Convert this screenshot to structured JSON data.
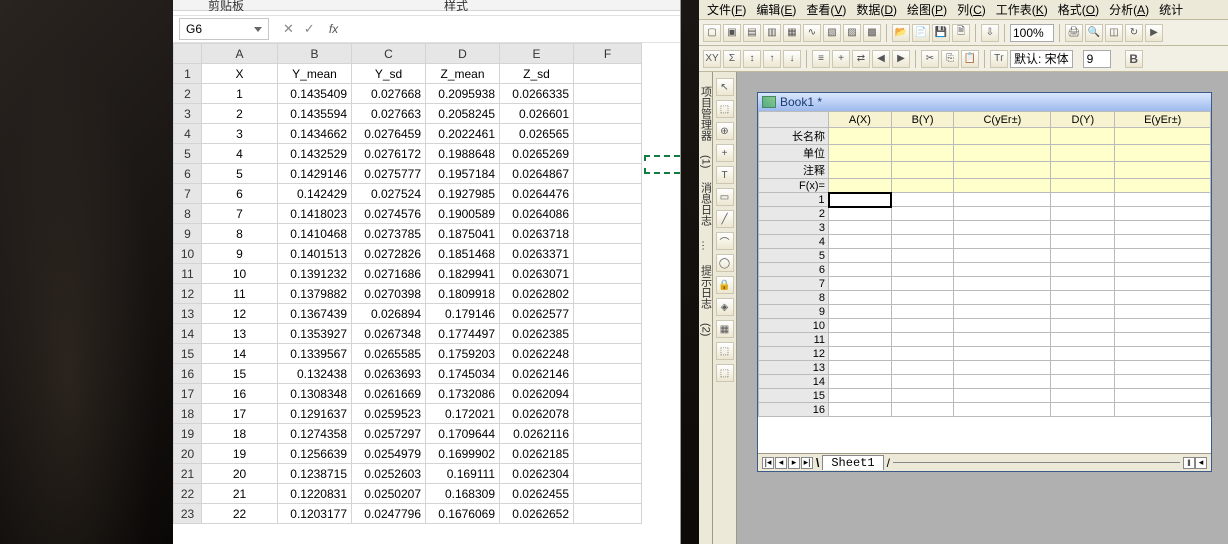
{
  "excel": {
    "ribbon": {
      "clipboard": "剪贴板",
      "styles": "样式"
    },
    "namebox": "G6",
    "fx": "fx",
    "columns": [
      "A",
      "B",
      "C",
      "D",
      "E",
      "F"
    ],
    "headers": [
      "X",
      "Y_mean",
      "Y_sd",
      "Z_mean",
      "Z_sd"
    ],
    "rows": [
      {
        "n": 1,
        "x": "1",
        "ym": "0.1435409",
        "ys": "0.027668",
        "zm": "0.2095938",
        "zs": "0.0266335"
      },
      {
        "n": 2,
        "x": "2",
        "ym": "0.1435594",
        "ys": "0.027663",
        "zm": "0.2058245",
        "zs": "0.026601"
      },
      {
        "n": 3,
        "x": "3",
        "ym": "0.1434662",
        "ys": "0.0276459",
        "zm": "0.2022461",
        "zs": "0.026565"
      },
      {
        "n": 4,
        "x": "4",
        "ym": "0.1432529",
        "ys": "0.0276172",
        "zm": "0.1988648",
        "zs": "0.0265269"
      },
      {
        "n": 5,
        "x": "5",
        "ym": "0.1429146",
        "ys": "0.0275777",
        "zm": "0.1957184",
        "zs": "0.0264867"
      },
      {
        "n": 6,
        "x": "6",
        "ym": "0.142429",
        "ys": "0.027524",
        "zm": "0.1927985",
        "zs": "0.0264476"
      },
      {
        "n": 7,
        "x": "7",
        "ym": "0.1418023",
        "ys": "0.0274576",
        "zm": "0.1900589",
        "zs": "0.0264086"
      },
      {
        "n": 8,
        "x": "8",
        "ym": "0.1410468",
        "ys": "0.0273785",
        "zm": "0.1875041",
        "zs": "0.0263718"
      },
      {
        "n": 9,
        "x": "9",
        "ym": "0.1401513",
        "ys": "0.0272826",
        "zm": "0.1851468",
        "zs": "0.0263371"
      },
      {
        "n": 10,
        "x": "10",
        "ym": "0.1391232",
        "ys": "0.0271686",
        "zm": "0.1829941",
        "zs": "0.0263071"
      },
      {
        "n": 11,
        "x": "11",
        "ym": "0.1379882",
        "ys": "0.0270398",
        "zm": "0.1809918",
        "zs": "0.0262802"
      },
      {
        "n": 12,
        "x": "12",
        "ym": "0.1367439",
        "ys": "0.026894",
        "zm": "0.179146",
        "zs": "0.0262577"
      },
      {
        "n": 13,
        "x": "13",
        "ym": "0.1353927",
        "ys": "0.0267348",
        "zm": "0.1774497",
        "zs": "0.0262385"
      },
      {
        "n": 14,
        "x": "14",
        "ym": "0.1339567",
        "ys": "0.0265585",
        "zm": "0.1759203",
        "zs": "0.0262248"
      },
      {
        "n": 15,
        "x": "15",
        "ym": "0.132438",
        "ys": "0.0263693",
        "zm": "0.1745034",
        "zs": "0.0262146"
      },
      {
        "n": 16,
        "x": "16",
        "ym": "0.1308348",
        "ys": "0.0261669",
        "zm": "0.1732086",
        "zs": "0.0262094"
      },
      {
        "n": 17,
        "x": "17",
        "ym": "0.1291637",
        "ys": "0.0259523",
        "zm": "0.172021",
        "zs": "0.0262078"
      },
      {
        "n": 18,
        "x": "18",
        "ym": "0.1274358",
        "ys": "0.0257297",
        "zm": "0.1709644",
        "zs": "0.0262116"
      },
      {
        "n": 19,
        "x": "19",
        "ym": "0.1256639",
        "ys": "0.0254979",
        "zm": "0.1699902",
        "zs": "0.0262185"
      },
      {
        "n": 20,
        "x": "20",
        "ym": "0.1238715",
        "ys": "0.0252603",
        "zm": "0.169111",
        "zs": "0.0262304"
      },
      {
        "n": 21,
        "x": "21",
        "ym": "0.1220831",
        "ys": "0.0250207",
        "zm": "0.168309",
        "zs": "0.0262455"
      },
      {
        "n": 22,
        "x": "22",
        "ym": "0.1203177",
        "ys": "0.0247796",
        "zm": "0.1676069",
        "zs": "0.0262652"
      }
    ]
  },
  "origin": {
    "menus": [
      "文件(F)",
      "编辑(E)",
      "查看(V)",
      "数据(D)",
      "绘图(P)",
      "列(C)",
      "工作表(K)",
      "格式(O)",
      "分析(A)",
      "统计"
    ],
    "zoom": "100%",
    "font_label": "默认: 宋体",
    "font_size": "9",
    "bold": "B",
    "book_title": "Book1 *",
    "cols": [
      "A(X)",
      "B(Y)",
      "C(yEr±)",
      "D(Y)",
      "E(yEr±)"
    ],
    "row_hdrs": [
      "长名称",
      "单位",
      "注释",
      "F(x)="
    ],
    "num_rows": 16,
    "sheet": "Sheet1",
    "side": [
      "项目管理器",
      "(1)",
      "消息日志",
      "…",
      "提示日志",
      "(2)"
    ],
    "mid_icons": [
      "↖",
      "⬚",
      "⊕",
      "+",
      "T",
      "▭",
      "╱",
      "⌒",
      "◯",
      "🔒",
      "◈",
      "▦",
      "⬚",
      "⬚"
    ]
  }
}
